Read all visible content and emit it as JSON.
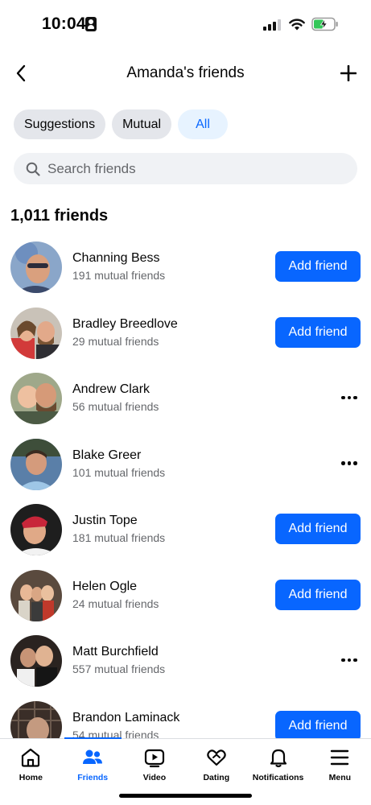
{
  "status_bar": {
    "time": "10:04"
  },
  "header": {
    "title": "Amanda's friends"
  },
  "filters": [
    {
      "label": "Suggestions",
      "active": false
    },
    {
      "label": "Mutual",
      "active": false
    },
    {
      "label": "All",
      "active": true
    }
  ],
  "search": {
    "placeholder": "Search friends",
    "value": ""
  },
  "friends_count": "1,011 friends",
  "friends": [
    {
      "name": "Channing Bess",
      "mutual": "191 mutual friends",
      "action": "Add friend"
    },
    {
      "name": "Bradley Breedlove",
      "mutual": "29 mutual friends",
      "action": "Add friend"
    },
    {
      "name": "Andrew Clark",
      "mutual": "56 mutual friends",
      "action": "more"
    },
    {
      "name": "Blake Greer",
      "mutual": "101 mutual friends",
      "action": "more"
    },
    {
      "name": "Justin Tope",
      "mutual": "181 mutual friends",
      "action": "Add friend"
    },
    {
      "name": "Helen Ogle",
      "mutual": "24 mutual friends",
      "action": "Add friend"
    },
    {
      "name": "Matt Burchfield",
      "mutual": "557 mutual friends",
      "action": "more"
    },
    {
      "name": "Brandon Laminack",
      "mutual": "54 mutual friends",
      "action": "Add friend"
    }
  ],
  "add_friend_label": "Add friend",
  "tabs": [
    {
      "label": "Home",
      "icon": "home-icon",
      "active": false
    },
    {
      "label": "Friends",
      "icon": "friends-icon",
      "active": true
    },
    {
      "label": "Video",
      "icon": "video-icon",
      "active": false
    },
    {
      "label": "Dating",
      "icon": "dating-icon",
      "active": false
    },
    {
      "label": "Notifications",
      "icon": "bell-icon",
      "active": false
    },
    {
      "label": "Menu",
      "icon": "menu-icon",
      "active": false
    }
  ],
  "colors": {
    "accent": "#0866ff",
    "chip_bg": "#e4e6eb",
    "chip_active_bg": "#e7f3ff",
    "secondary_text": "#65676b"
  }
}
